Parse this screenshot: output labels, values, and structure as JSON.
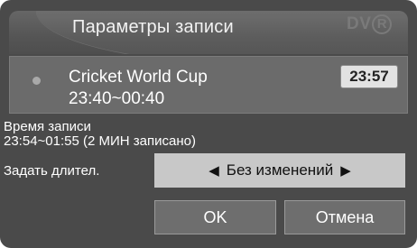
{
  "dialog": {
    "title": "Параметры записи",
    "logo_text": "DV",
    "logo_circle": "R"
  },
  "program": {
    "name": "Cricket World Cup",
    "time": "23:40~00:40",
    "clock": "23:57"
  },
  "recording": {
    "label": "Время записи",
    "detail": "23:54~01:55  (2 МИН записано)"
  },
  "duration": {
    "label": "Задать длител.",
    "value": "Без изменений",
    "left_arrow": "◀",
    "right_arrow": "▶"
  },
  "buttons": {
    "ok_label": "OK",
    "cancel_label": "Отмена"
  },
  "colors": {
    "background": "#4a4a4a",
    "selector": "#c8c8c8",
    "button": "#6e6e6e"
  }
}
